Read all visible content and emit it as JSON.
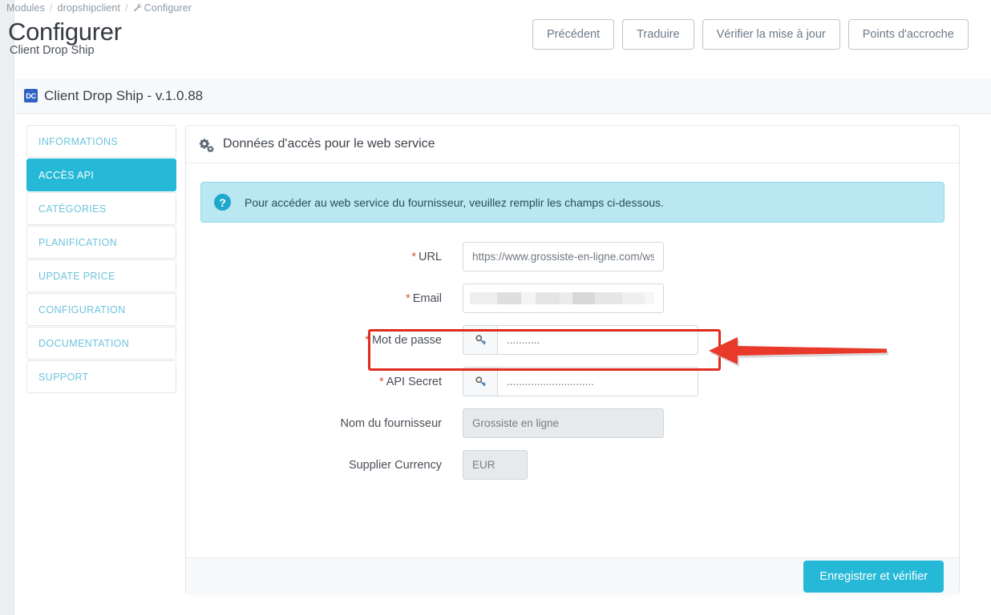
{
  "breadcrumb": {
    "items": [
      "Modules",
      "dropshipclient",
      "Configurer"
    ],
    "separator": "/"
  },
  "header": {
    "title": "Configurer",
    "subtitle": "Client Drop Ship"
  },
  "toolbar": {
    "buttons": [
      {
        "label": "Précédent"
      },
      {
        "label": "Traduire"
      },
      {
        "label": "Vérifier la mise à jour"
      },
      {
        "label": "Points d'accroche"
      }
    ]
  },
  "module_bar": {
    "icon_text": "DC",
    "title": "Client Drop Ship - v.1.0.88"
  },
  "sidebar": {
    "items": [
      {
        "label": "INFORMATIONS",
        "active": false
      },
      {
        "label": "ACCÈS API",
        "active": true
      },
      {
        "label": "CATÉGORIES",
        "active": false
      },
      {
        "label": "PLANIFICATION",
        "active": false
      },
      {
        "label": "UPDATE PRICE",
        "active": false
      },
      {
        "label": "CONFIGURATION",
        "active": false
      },
      {
        "label": "DOCUMENTATION",
        "active": false
      },
      {
        "label": "SUPPORT",
        "active": false
      }
    ]
  },
  "panel": {
    "title": "Données d'accès pour le web service",
    "alert": {
      "icon": "question-circle-icon",
      "text": "Pour accéder au web service du fournisseur, veuillez remplir les champs ci-dessous."
    },
    "fields": {
      "url": {
        "label": "URL",
        "required": true,
        "value": "https://www.grossiste-en-ligne.com/ws"
      },
      "email": {
        "label": "Email",
        "required": true,
        "value": ""
      },
      "password": {
        "label": "Mot de passe",
        "required": true,
        "value": "...........",
        "addon_icon": "key-icon"
      },
      "api_secret": {
        "label": "API Secret",
        "required": true,
        "value": ".............................",
        "addon_icon": "key-icon"
      },
      "supplier_name": {
        "label": "Nom du fournisseur",
        "required": false,
        "value": "Grossiste en ligne",
        "disabled": true
      },
      "supplier_currency": {
        "label": "Supplier Currency",
        "required": false,
        "value": "EUR",
        "disabled": true
      }
    },
    "required_marker": "*",
    "submit_label": "Enregistrer et vérifier"
  },
  "colors": {
    "accent": "#25b9d7",
    "alert_bg": "#b9e7f2",
    "highlight": "#e02b20",
    "module_icon": "#2f62c4"
  }
}
